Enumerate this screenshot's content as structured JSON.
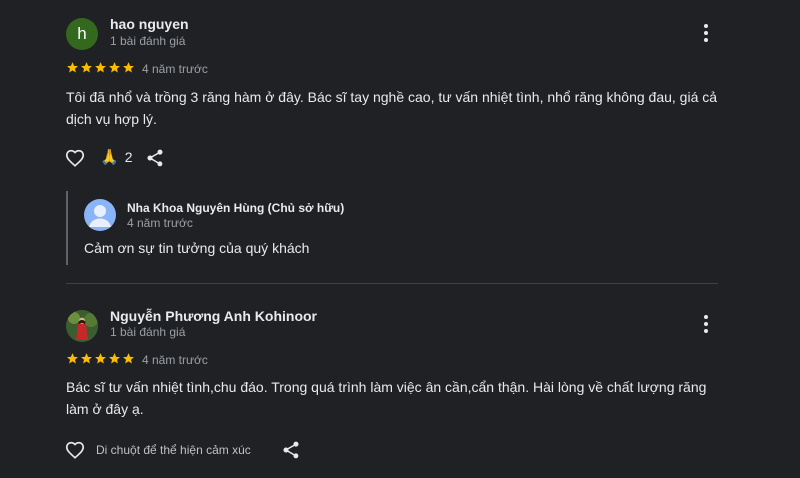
{
  "reviews": [
    {
      "avatar_letter": "h",
      "name": "hao nguyen",
      "count": "1 bài đánh giá",
      "rating": 5,
      "date": "4 năm trước",
      "text": "Tôi đã nhổ và trồng 3 răng hàm ở đây. Bác sĩ tay nghề cao, tư vấn nhiệt tình, nhổ răng không đau, giá cả dịch vụ hợp lý.",
      "reaction_count": "2",
      "reply": {
        "owner_name": "Nha Khoa Nguyên Hùng (Chủ sở hữu)",
        "date": "4 năm trước",
        "text": "Cảm ơn sự tin tưởng của quý khách"
      }
    },
    {
      "name": "Nguyễn Phương Anh Kohinoor",
      "count": "1 bài đánh giá",
      "rating": 5,
      "date": "4 năm trước",
      "text": "Bác sĩ tư vấn nhiệt tình,chu đáo. Trong quá trình làm việc ân cần,cẩn thận. Hài lòng về chất lượng răng làm ở đây ạ.",
      "hover_hint": "Di chuột để thể hiện cảm xúc"
    }
  ],
  "colors": {
    "background": "#202124",
    "star": "#fbbc04",
    "avatar_green": "#33691e",
    "owner_avatar": "#8ab4f8"
  },
  "icons": [
    "more-vert-icon",
    "heart-icon",
    "pray-emoji-icon",
    "share-icon",
    "star-icon",
    "person-icon"
  ]
}
